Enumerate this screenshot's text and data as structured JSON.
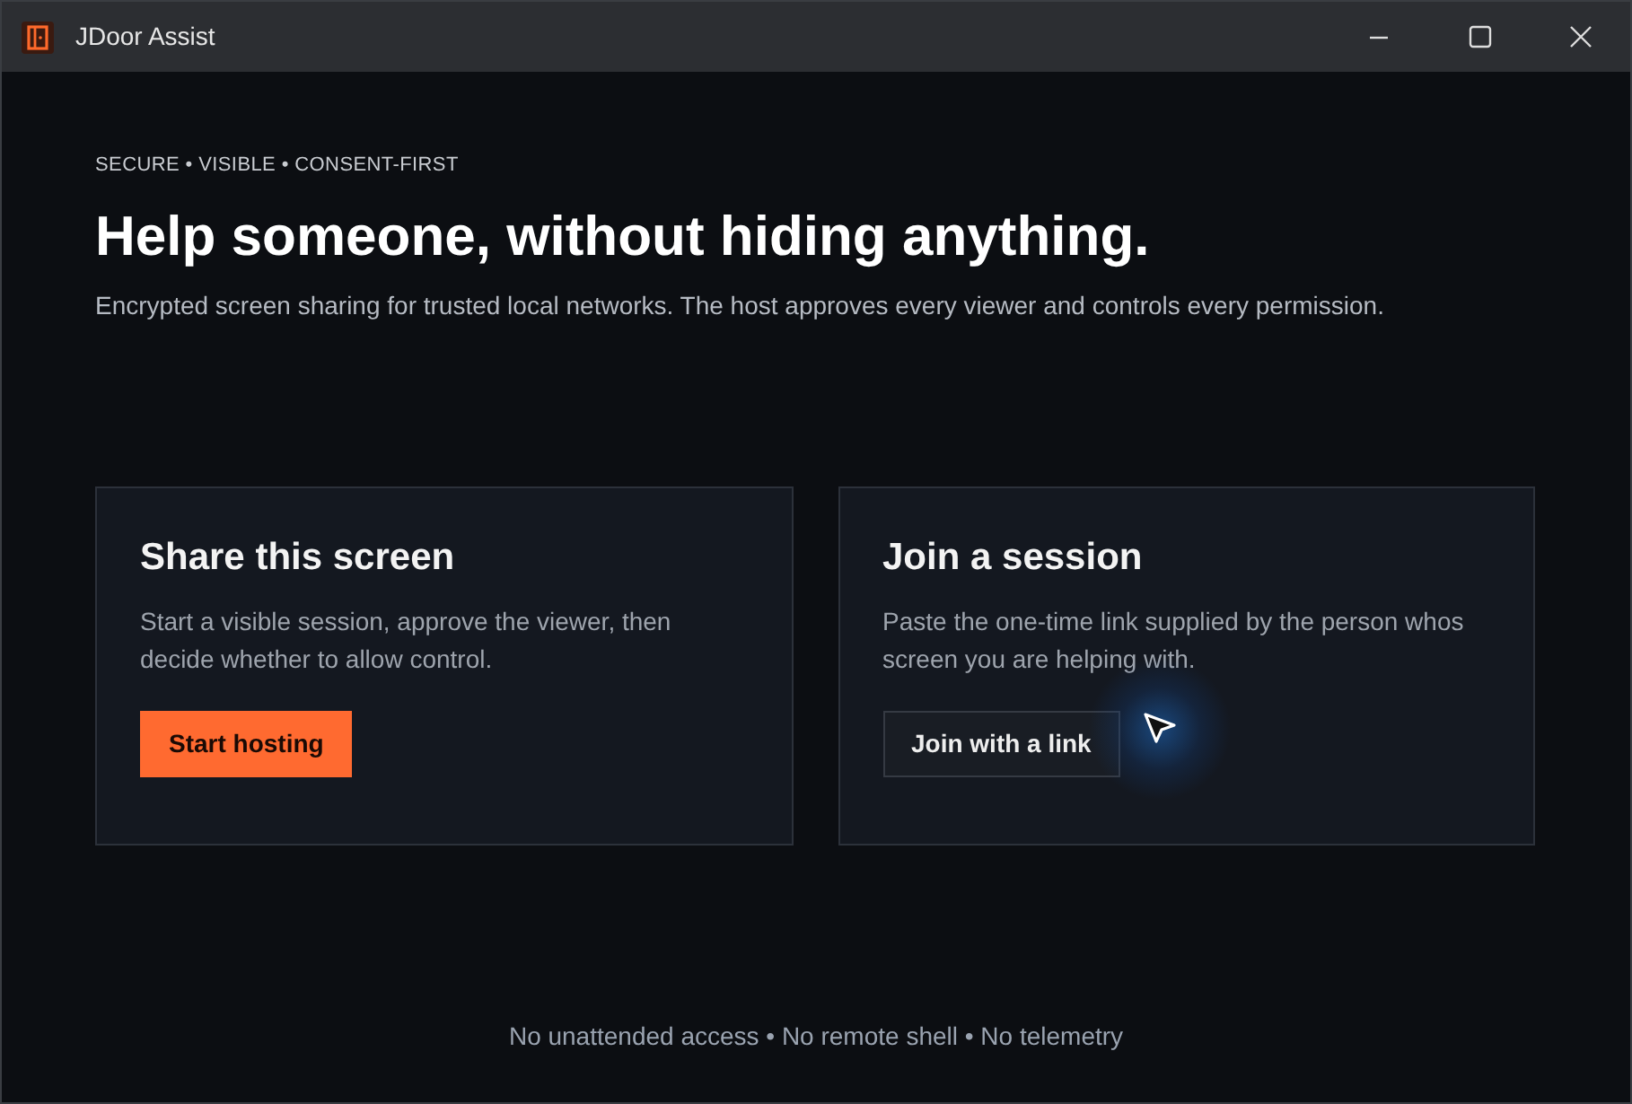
{
  "window": {
    "title": "JDoor Assist"
  },
  "hero": {
    "eyebrow": "SECURE • VISIBLE • CONSENT-FIRST",
    "headline": "Help someone, without hiding anything.",
    "subtitle": "Encrypted screen sharing for trusted local networks. The host approves every viewer and controls every permission."
  },
  "cards": [
    {
      "title": "Share this screen",
      "lines": [
        "Start a visible session, approve the viewer, then",
        "decide whether to allow control."
      ],
      "button": {
        "label": "Start hosting",
        "kind": "primary"
      }
    },
    {
      "title": "Join a session",
      "lines": [
        "Paste the one-time link supplied by the person whos",
        "screen you are helping with."
      ],
      "button": {
        "label": "Join with a link",
        "kind": "secondary"
      }
    }
  ],
  "footer": "No unattended access • No remote shell • No telemetry"
}
